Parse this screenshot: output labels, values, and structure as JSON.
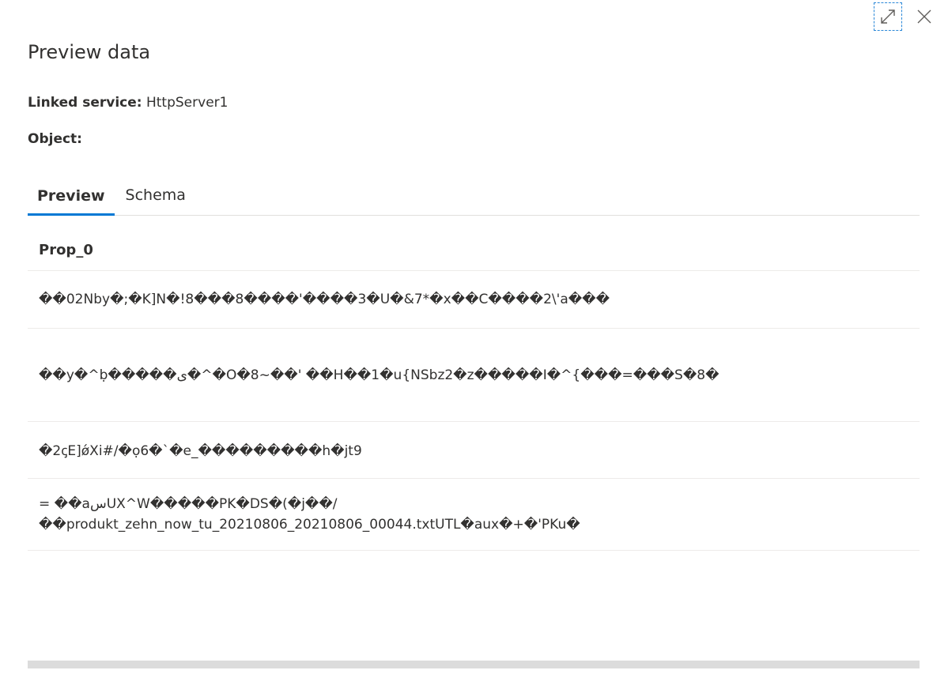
{
  "title": "Preview data",
  "linked_service": {
    "label": "Linked service:",
    "value": "HttpServer1"
  },
  "object": {
    "label": "Object:",
    "value": ""
  },
  "tabs": [
    {
      "label": "Preview",
      "active": true
    },
    {
      "label": "Schema",
      "active": false
    }
  ],
  "grid": {
    "column": "Prop_0",
    "rows": [
      {
        "line1": "��02Nby�;�K]N�!8���8����'����3�U�&7*�x��C����2\\'a���"
      },
      {
        "line1": "��y�^ḅ�����ی�^�O�8~��'  ��H��1�u{NSbz2�z�����I�^{���=���S�8�"
      },
      {
        "line1": "�2ꞔE]ǿXi#/�ọ6�`�e_���������h�jt9"
      },
      {
        "line1": "= ��aسUX^W�����PK�DS�(�j��/",
        "line2": "��produkt_zehn_now_tu_20210806_20210806_00044.txtUTL�aux�+�'PKu�"
      }
    ]
  },
  "icons": {
    "expand": "expand-icon",
    "close": "close-icon"
  },
  "colors": {
    "accent": "#0078d4",
    "text": "#323130",
    "divider": "#edebe9"
  }
}
